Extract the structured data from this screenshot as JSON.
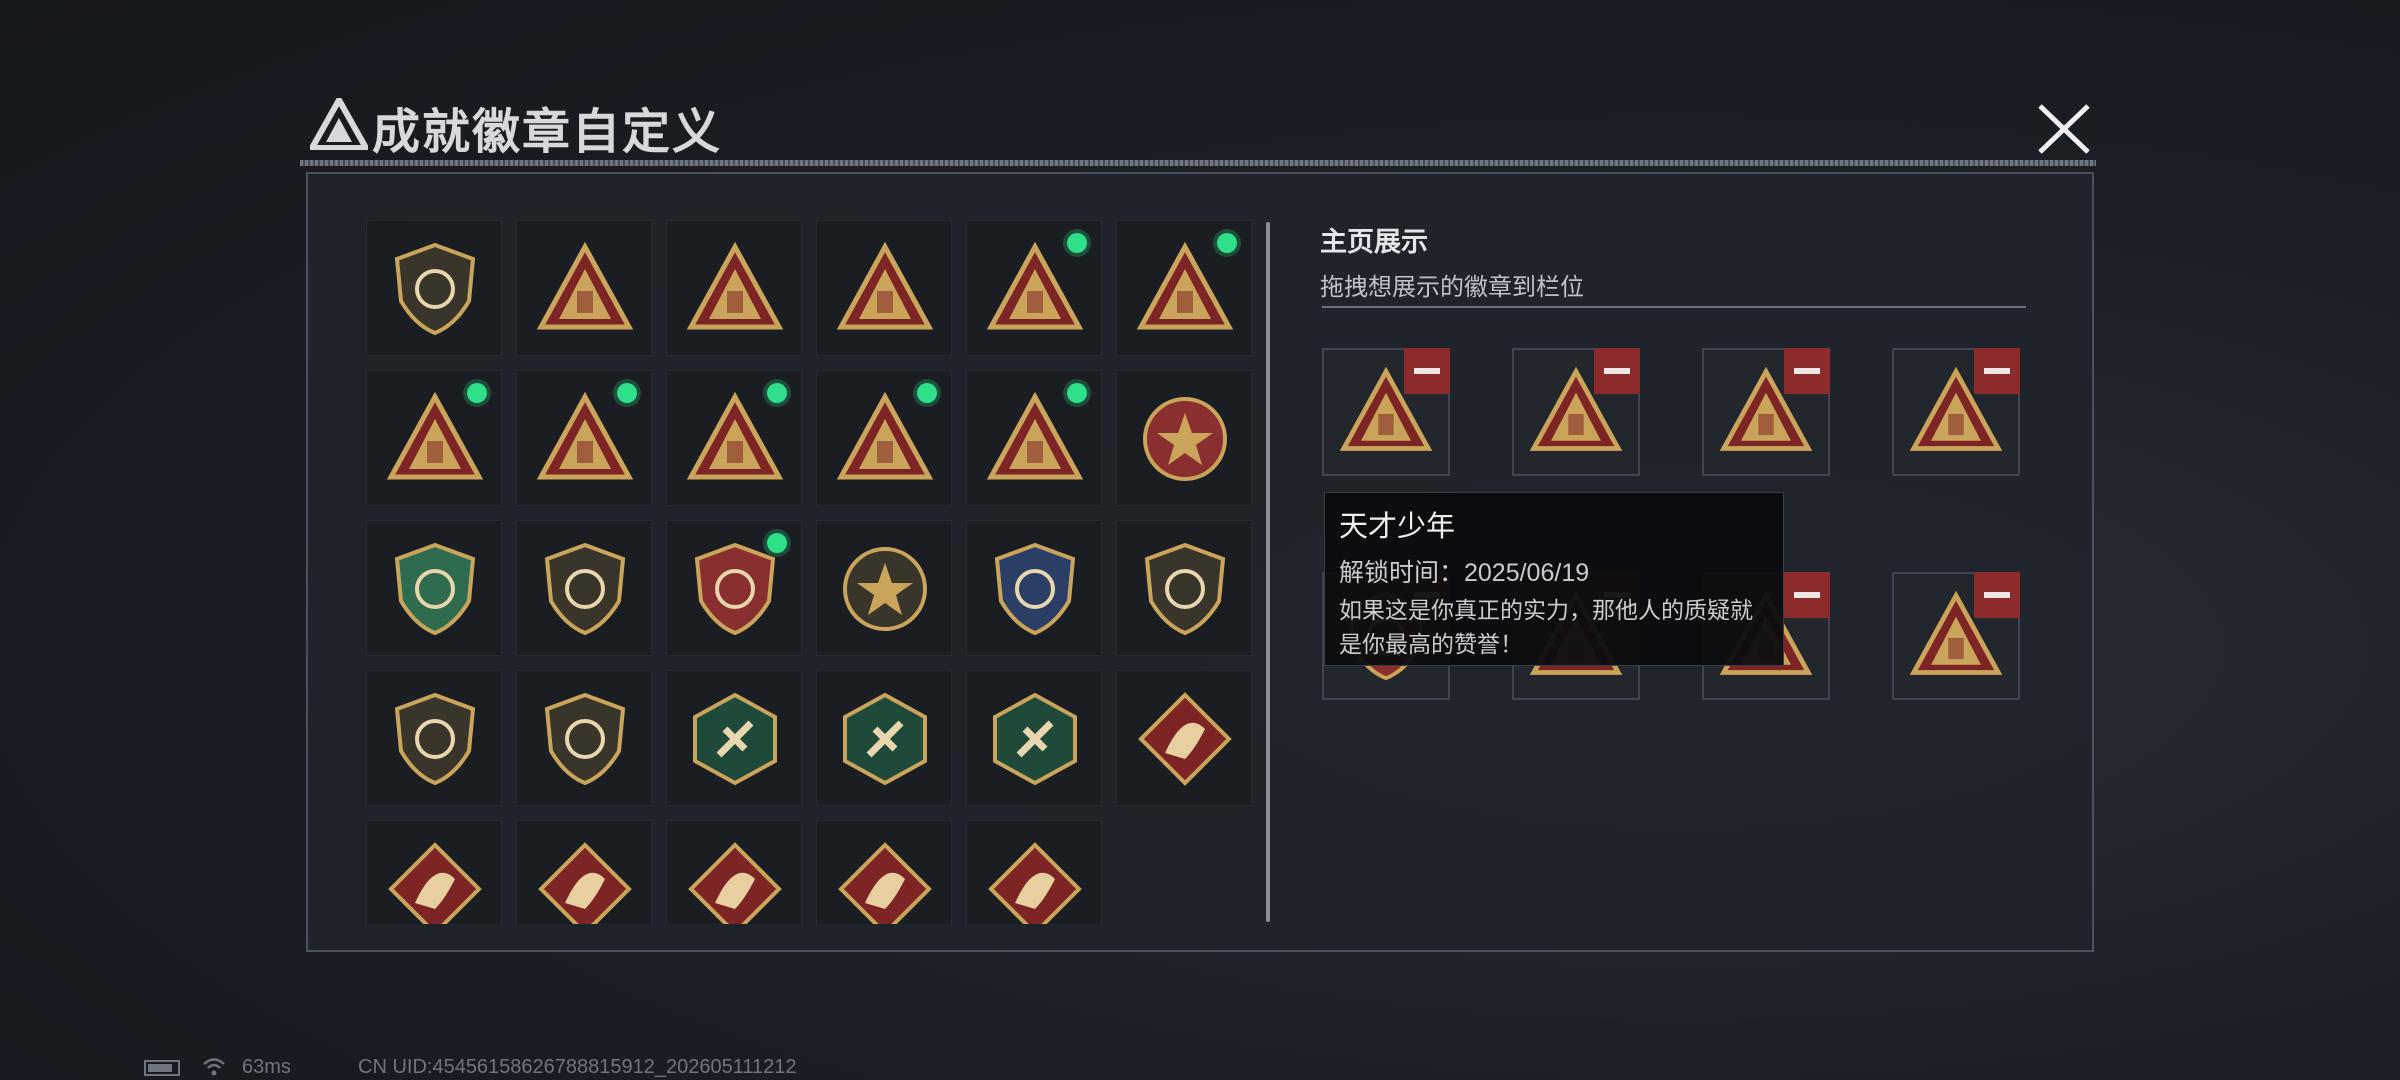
{
  "header": {
    "title": "成就徽章自定义"
  },
  "badge_grid": [
    {
      "icon": "shield-triangle-badge-icon",
      "new": false
    },
    {
      "icon": "helicopter-badge-icon",
      "new": false
    },
    {
      "icon": "pack-55-badge-icon",
      "new": false
    },
    {
      "icon": "box-58-badge-icon",
      "new": false
    },
    {
      "icon": "egg-nest-badge-icon",
      "new": true
    },
    {
      "icon": "number-one-badge-icon",
      "new": true
    },
    {
      "icon": "usb-badge-icon",
      "new": true
    },
    {
      "icon": "runner-badge-icon",
      "new": true
    },
    {
      "icon": "hands-dice-badge-icon",
      "new": true
    },
    {
      "icon": "soldiers-badge-icon",
      "new": true
    },
    {
      "icon": "rocket-badge-icon",
      "new": true
    },
    {
      "icon": "star-medal-badge-icon",
      "new": false
    },
    {
      "icon": "green-wreath-badge-icon",
      "new": false
    },
    {
      "icon": "gold-shield-badge-icon",
      "new": false
    },
    {
      "icon": "red-shield-badge-icon",
      "new": true
    },
    {
      "icon": "sniper-skull-badge-icon",
      "new": false
    },
    {
      "icon": "blue-rifle-badge-icon",
      "new": false
    },
    {
      "icon": "smg-scope-badge-icon",
      "new": false
    },
    {
      "icon": "knife-shield-badge-icon",
      "new": false
    },
    {
      "icon": "anchor-shield-badge-icon",
      "new": false
    },
    {
      "icon": "wasp-hex-badge-icon",
      "new": false
    },
    {
      "icon": "wasp-hex-2-badge-icon",
      "new": false
    },
    {
      "icon": "hammer-hex-badge-icon",
      "new": false
    },
    {
      "icon": "dragon-diamond-badge-icon",
      "new": false
    },
    {
      "icon": "dragon-diamond-2-badge-icon",
      "new": false
    },
    {
      "icon": "monkey-diamond-badge-icon",
      "new": false
    },
    {
      "icon": "horse-diamond-badge-icon",
      "new": false
    },
    {
      "icon": "horse-diamond-2-badge-icon",
      "new": false
    },
    {
      "icon": "hammer-sickle-diamond-badge-icon",
      "new": false
    }
  ],
  "showcase": {
    "title": "主页展示",
    "subtitle": "拖拽想展示的徽章到栏位",
    "slots": [
      {
        "icon": "usb-badge-icon"
      },
      {
        "icon": "runner-badge-icon"
      },
      {
        "icon": "egg-nest-badge-icon"
      },
      {
        "icon": "hands-dice-badge-icon"
      },
      {
        "icon": "red-shield-badge-icon"
      },
      {
        "icon": "number-one-badge-icon"
      },
      {
        "icon": "rocket-badge-icon"
      },
      {
        "icon": "soldiers-badge-icon"
      }
    ]
  },
  "tooltip": {
    "name": "天才少年",
    "unlock_time": "解锁时间：2025/06/19",
    "description": "如果这是你真正的实力，那他人的质疑就是你最高的赞誉！"
  },
  "status_bar": {
    "ping": "63ms",
    "uid": "CN UID:454561586267888159​12_202605111212"
  },
  "colors": {
    "accent_new": "#2fe08a",
    "remove": "#8c2b2b",
    "badge_gold": "#c9a45a",
    "badge_red": "#7d2424"
  }
}
